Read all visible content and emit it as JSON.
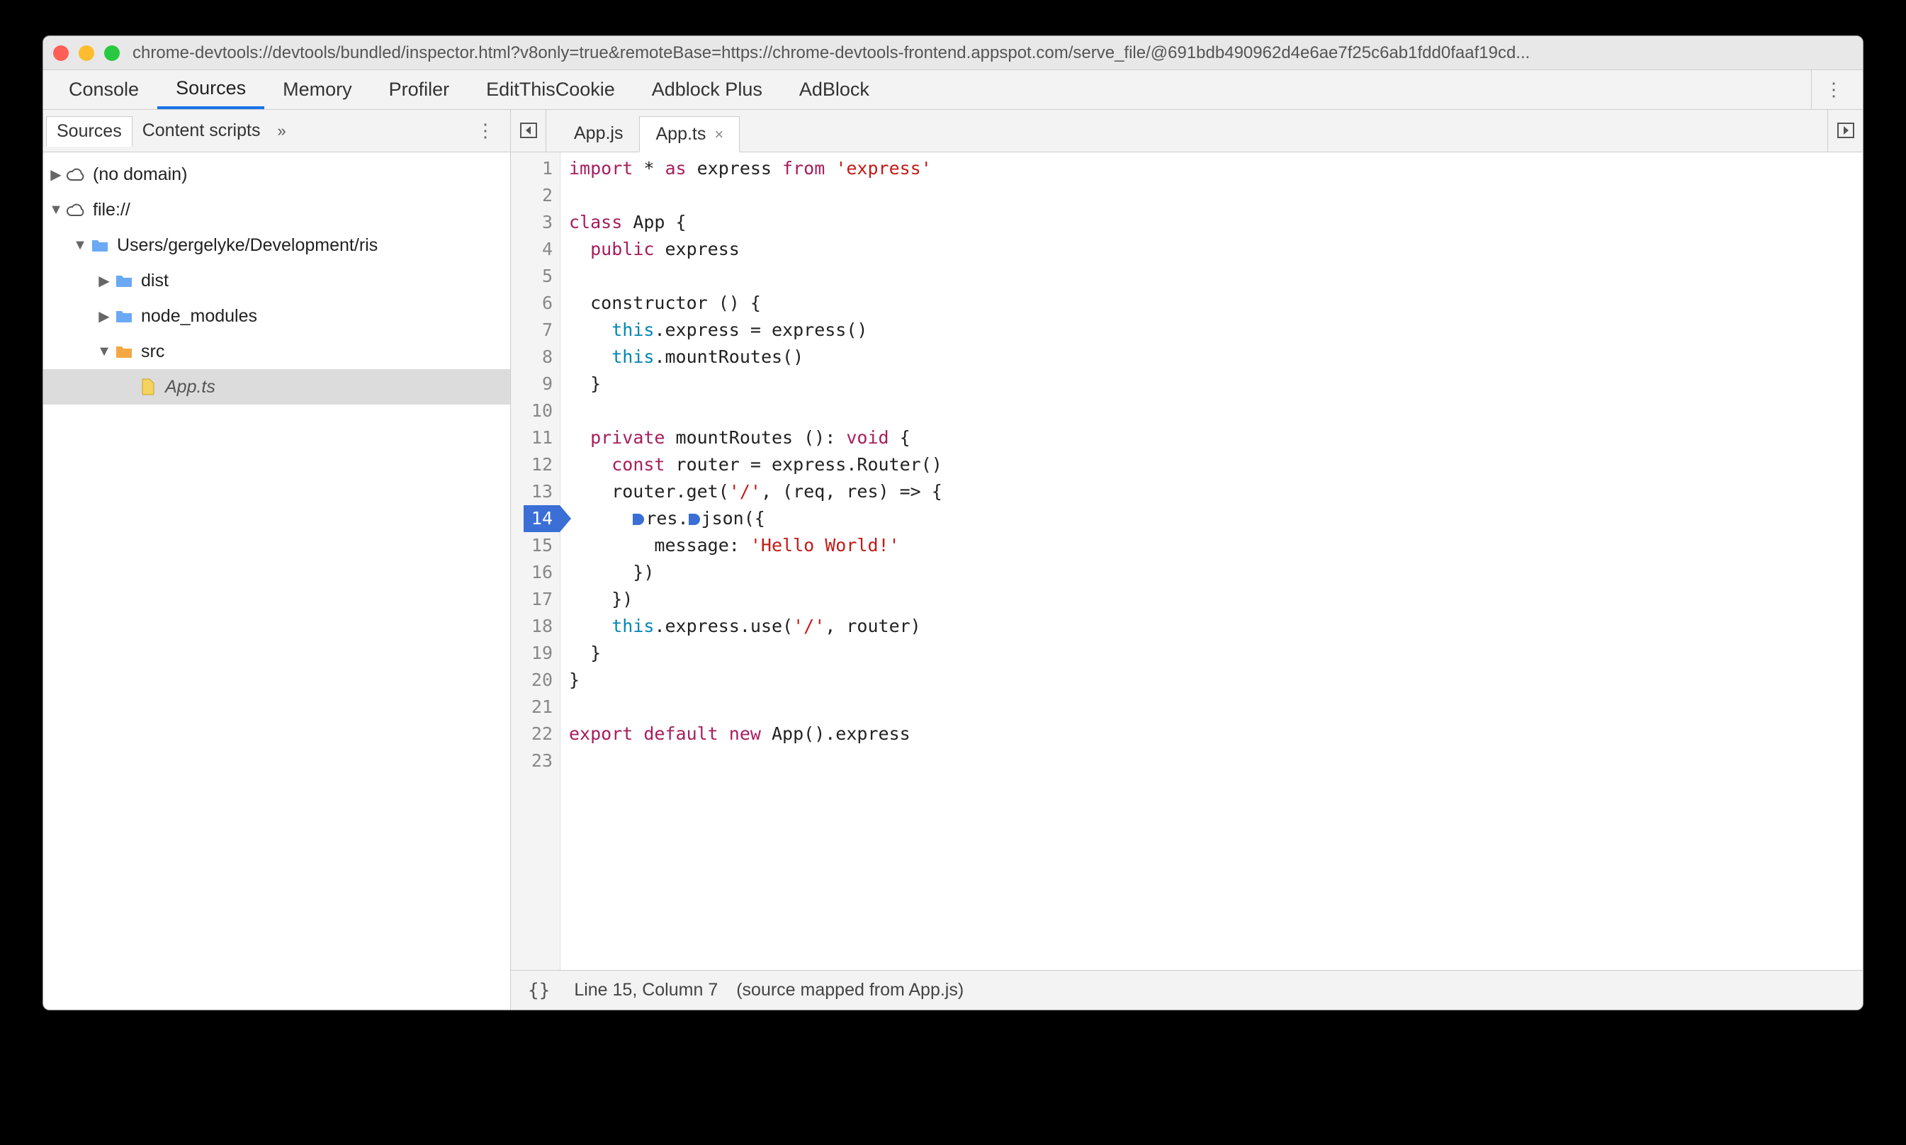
{
  "window": {
    "url": "chrome-devtools://devtools/bundled/inspector.html?v8only=true&remoteBase=https://chrome-devtools-frontend.appspot.com/serve_file/@691bdb490962d4e6ae7f25c6ab1fdd0faaf19cd..."
  },
  "top_tabs": [
    "Console",
    "Sources",
    "Memory",
    "Profiler",
    "EditThisCookie",
    "Adblock Plus",
    "AdBlock"
  ],
  "top_tab_active": "Sources",
  "sidebar_tabs": [
    "Sources",
    "Content scripts"
  ],
  "sidebar_tab_active": "Sources",
  "sidebar_overflow_glyph": "»",
  "tree": [
    {
      "depth": 0,
      "arrow": "▶",
      "icon": "cloud",
      "label": "(no domain)",
      "sel": false
    },
    {
      "depth": 0,
      "arrow": "▼",
      "icon": "cloud",
      "label": "file://",
      "sel": false
    },
    {
      "depth": 1,
      "arrow": "▼",
      "icon": "folder-blue",
      "label": "Users/gergelyke/Development/ris",
      "sel": false
    },
    {
      "depth": 2,
      "arrow": "▶",
      "icon": "folder-blue",
      "label": "dist",
      "sel": false
    },
    {
      "depth": 2,
      "arrow": "▶",
      "icon": "folder-blue",
      "label": "node_modules",
      "sel": false
    },
    {
      "depth": 2,
      "arrow": "▼",
      "icon": "folder-orange",
      "label": "src",
      "sel": false
    },
    {
      "depth": 3,
      "arrow": "",
      "icon": "file",
      "label": "App.ts",
      "italic": true,
      "sel": true
    }
  ],
  "editor_tabs": [
    {
      "label": "App.js",
      "active": false,
      "closable": false
    },
    {
      "label": "App.ts",
      "active": true,
      "closable": true
    }
  ],
  "code_lines": [
    {
      "n": 1,
      "html": "<span class='kw'>import</span> * <span class='kw'>as</span> express <span class='kw'>from</span> <span class='str'>'express'</span>"
    },
    {
      "n": 2,
      "html": ""
    },
    {
      "n": 3,
      "html": "<span class='kw'>class</span> App {"
    },
    {
      "n": 4,
      "html": "  <span class='kw'>public</span> express"
    },
    {
      "n": 5,
      "html": ""
    },
    {
      "n": 6,
      "html": "  constructor () {"
    },
    {
      "n": 7,
      "html": "    <span class='kw2'>this</span>.express = express()"
    },
    {
      "n": 8,
      "html": "    <span class='kw2'>this</span>.mountRoutes()"
    },
    {
      "n": 9,
      "html": "  }"
    },
    {
      "n": 10,
      "html": ""
    },
    {
      "n": 11,
      "html": "  <span class='kw'>private</span> mountRoutes (): <span class='kw'>void</span> {"
    },
    {
      "n": 12,
      "html": "    <span class='kw'>const</span> router = express.Router()"
    },
    {
      "n": 13,
      "html": "    router.get(<span class='str'>'/'</span>, (req, res) =&gt; {"
    },
    {
      "n": 14,
      "bp": true,
      "html": "      <span class='bpmark'></span>res.<span class='bpmark'></span>json({"
    },
    {
      "n": 15,
      "html": "        message: <span class='str'>'Hello World!'</span>"
    },
    {
      "n": 16,
      "html": "      })"
    },
    {
      "n": 17,
      "html": "    })"
    },
    {
      "n": 18,
      "html": "    <span class='kw2'>this</span>.express.use(<span class='str'>'/'</span>, router)"
    },
    {
      "n": 19,
      "html": "  }"
    },
    {
      "n": 20,
      "html": "}"
    },
    {
      "n": 21,
      "html": ""
    },
    {
      "n": 22,
      "html": "<span class='kw'>export</span> <span class='kw'>default</span> <span class='kw'>new</span> App().express"
    },
    {
      "n": 23,
      "html": ""
    }
  ],
  "status": {
    "pos": "Line 15, Column 7",
    "mapped": "(source mapped from App.js)"
  }
}
